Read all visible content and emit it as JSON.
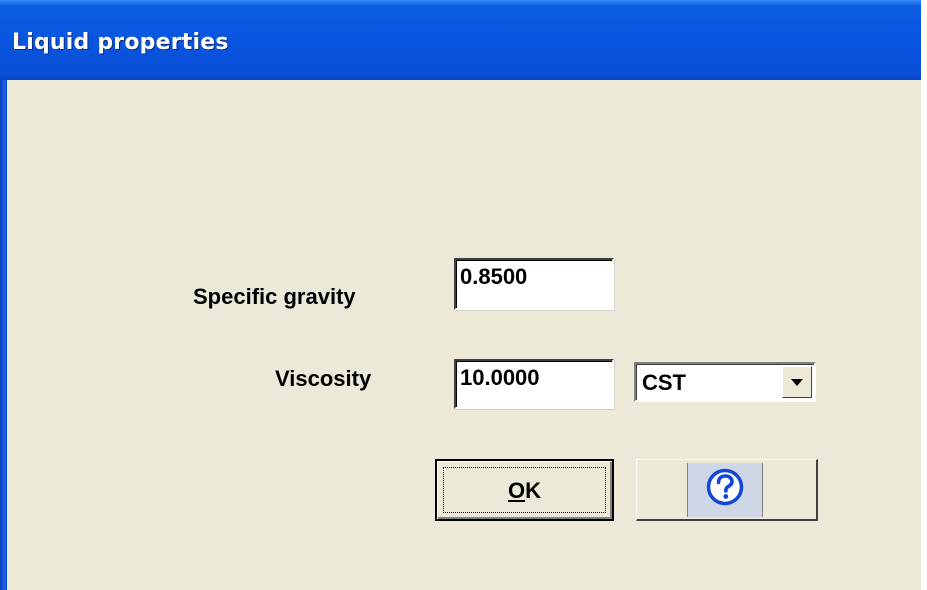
{
  "window": {
    "title": "Liquid properties"
  },
  "fields": {
    "specific_gravity": {
      "label": "Specific gravity",
      "value": "0.8500"
    },
    "viscosity": {
      "label": "Viscosity",
      "value": "10.0000",
      "unit_selected": "CST"
    }
  },
  "buttons": {
    "ok_prefix": "",
    "ok_mnemonic": "O",
    "ok_suffix": "K",
    "help_icon": "question-mark-circle-icon"
  },
  "colors": {
    "titlebar": "#0955e1",
    "dialog_bg": "#ece9d8",
    "help_icon": "#1047d6"
  }
}
